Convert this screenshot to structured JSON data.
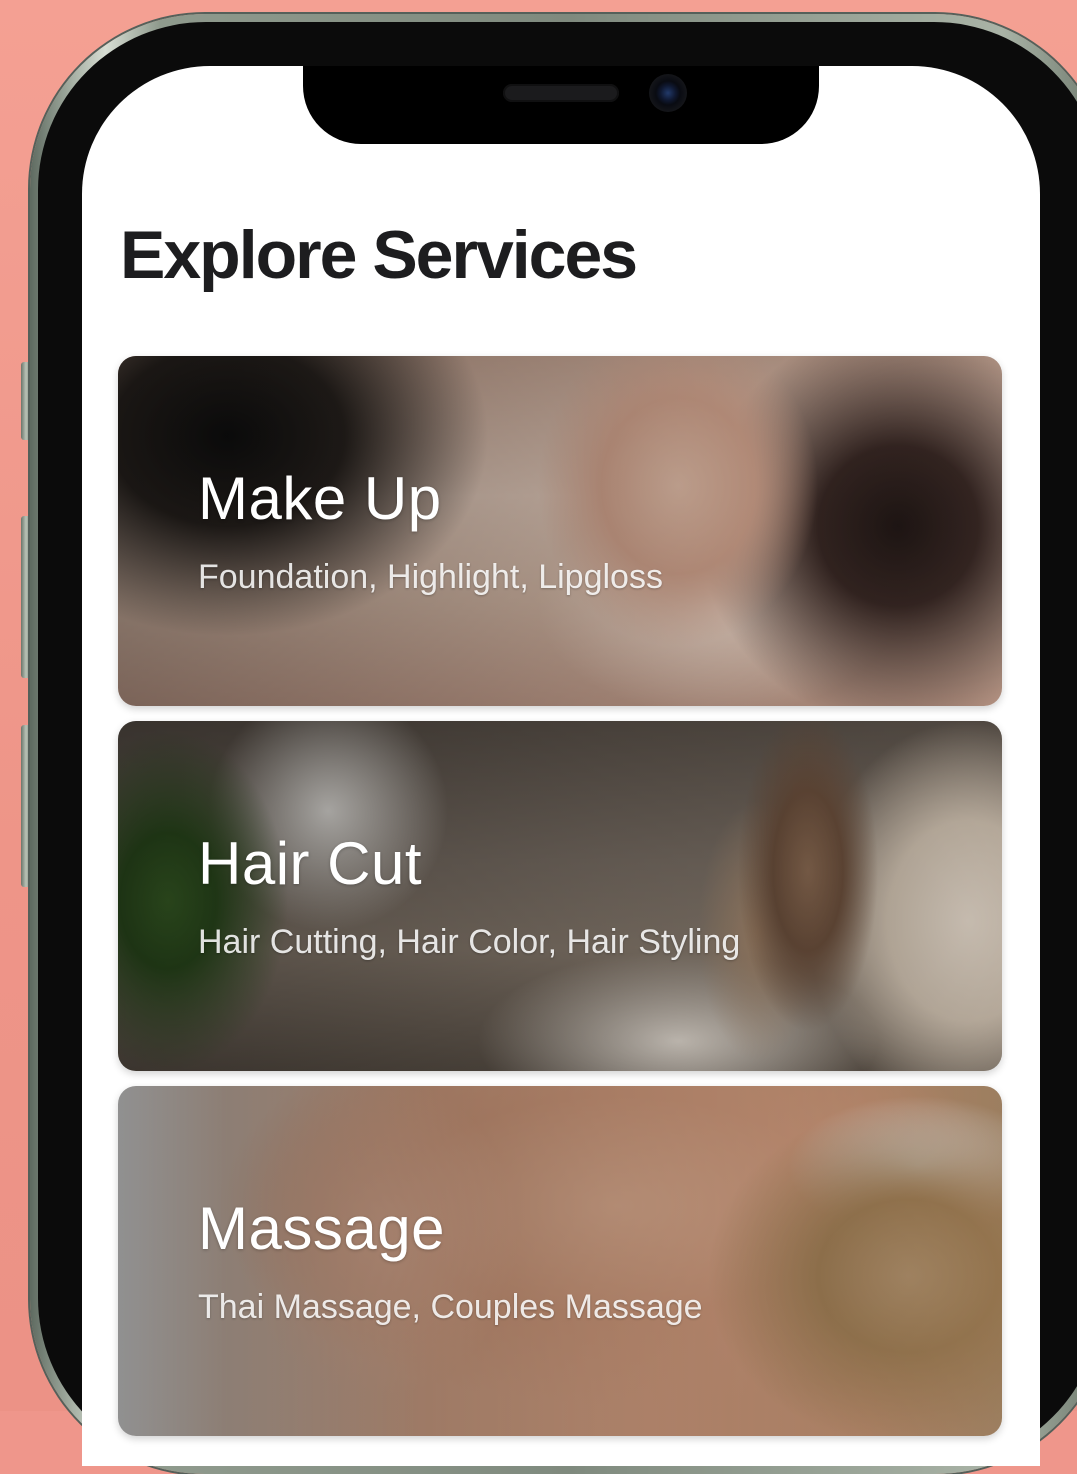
{
  "page": {
    "title": "Explore Services"
  },
  "services": [
    {
      "title": "Make Up",
      "subtitle": "Foundation, Highlight, Lipgloss"
    },
    {
      "title": "Hair Cut",
      "subtitle": "Hair Cutting, Hair Color, Hair Styling"
    },
    {
      "title": "Massage",
      "subtitle": "Thai Massage, Couples Massage"
    }
  ],
  "colors": {
    "background": "#ef968b",
    "title_text": "#1d1d1f",
    "card_text": "#ffffff"
  }
}
